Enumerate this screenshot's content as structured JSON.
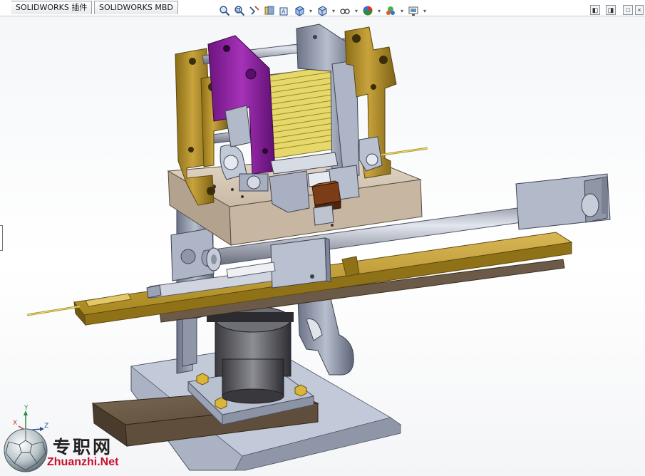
{
  "tabs": [
    {
      "label": "SOLIDWORKS 插件"
    },
    {
      "label": "SOLIDWORKS MBD"
    }
  ],
  "heads_up_toolbar": [
    {
      "icon": "zoom-to-fit-icon"
    },
    {
      "icon": "zoom-to-area-icon"
    },
    {
      "icon": "previous-view-icon"
    },
    {
      "icon": "section-view-icon"
    },
    {
      "icon": "dynamic-annotation-view-icon"
    },
    {
      "icon": "view-orientation-icon"
    },
    {
      "icon": "display-style-icon"
    },
    {
      "icon": "hide-show-items-icon"
    },
    {
      "icon": "edit-appearance-icon"
    },
    {
      "icon": "apply-scene-icon"
    },
    {
      "icon": "view-settings-icon"
    }
  ],
  "window_controls": [
    "restore-left-icon",
    "restore-right-icon",
    "maximize-icon",
    "close-icon"
  ],
  "triad": {
    "x": "X",
    "y": "Y",
    "z": "Z"
  },
  "watermark": {
    "cn": "专职网",
    "en": "Zhuanzhi.Net"
  },
  "colors": {
    "gold": "#b8932a",
    "gold_dark": "#7d6418",
    "purple": "#8b1c9e",
    "steel": "#9aa2b4",
    "steel_dark": "#5f6678",
    "plate": "#d9ccbc",
    "wood": "#6b5a46",
    "base": "#b5bccb"
  }
}
